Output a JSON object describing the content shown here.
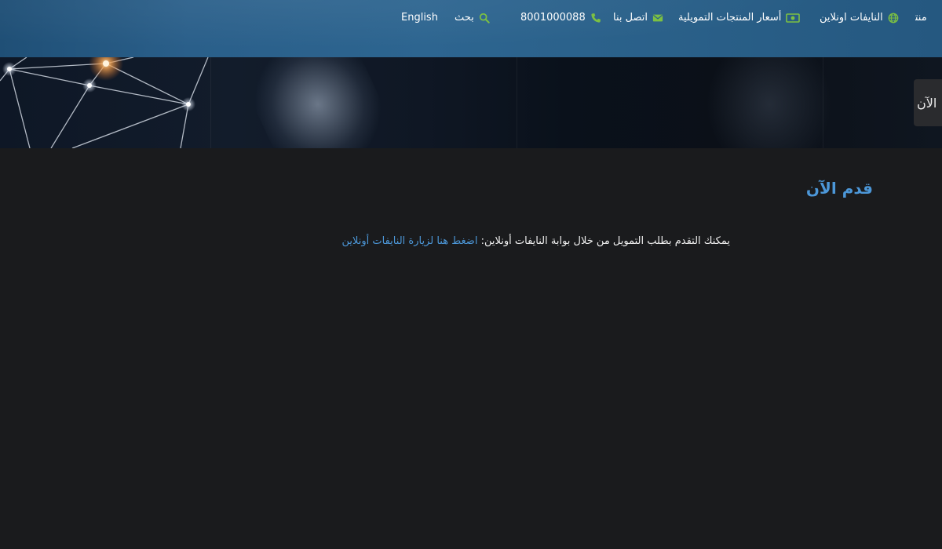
{
  "nav": {
    "products_label": "منتجاتنا",
    "online_label": "النايفات اونلاين",
    "prices_label": "أسعار المنتجات التمويلية",
    "contact_label": "اتصل بنا",
    "phone": "8001000088",
    "search_label": "بحث",
    "language_label": "English"
  },
  "icons": {
    "online": "globe-icon",
    "prices": "money-icon",
    "contact": "envelope-icon",
    "phone": "phone-icon",
    "search": "search-icon"
  },
  "hero": {
    "side_tab_label": "الآن"
  },
  "main": {
    "title": "قدم الآن",
    "intro_text": "يمكنك التقدم بطلب التمويل من خلال بوابة النايفات أونلاين:",
    "intro_link": "اضغط هنا لزيارة النايفات أونلاين"
  },
  "colors": {
    "accent_green": "#7cc043",
    "link_blue": "#4c97d8",
    "background": "#1a1b1d",
    "topbar": "#2a5f8a"
  }
}
